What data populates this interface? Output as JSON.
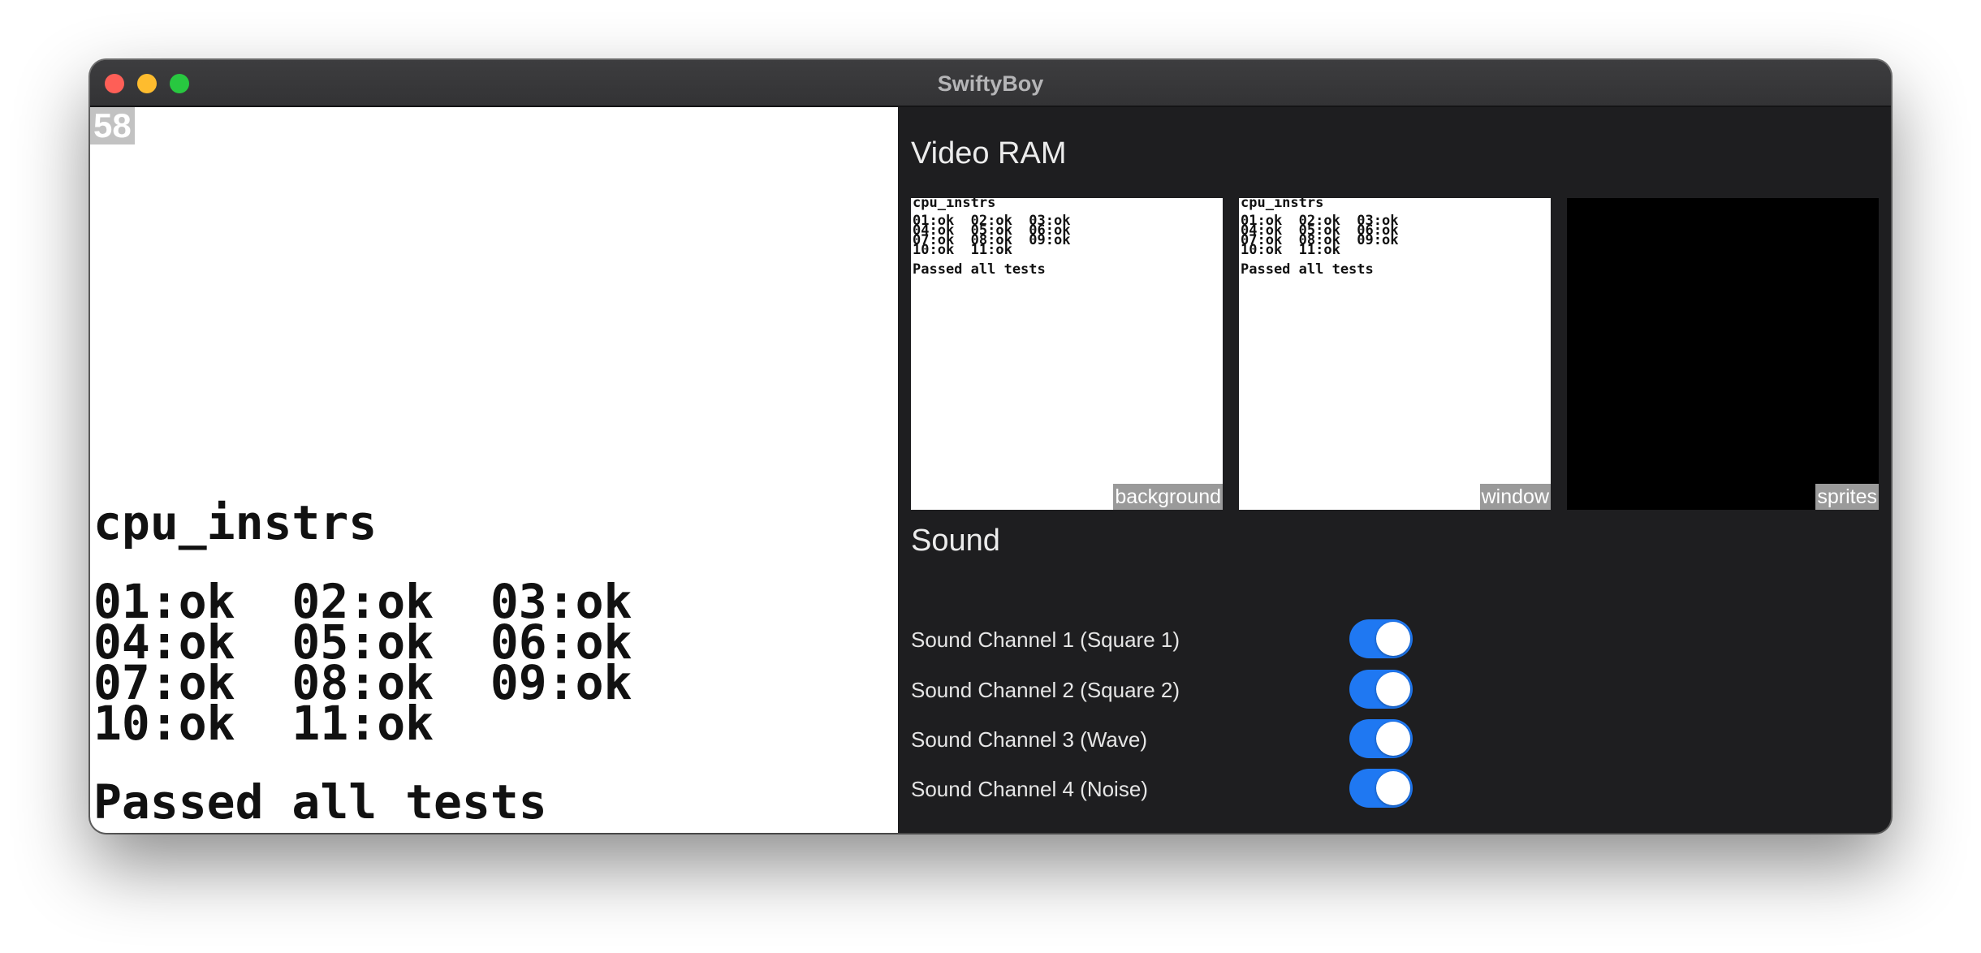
{
  "window": {
    "title": "SwiftyBoy"
  },
  "screen": {
    "fps": "58",
    "title": "cpu_instrs",
    "results": "01:ok  02:ok  03:ok\n04:ok  05:ok  06:ok\n07:ok  08:ok  09:ok\n10:ok  11:ok",
    "passed": "Passed all tests"
  },
  "vram": {
    "title": "Video RAM",
    "tiles": [
      {
        "label": "background",
        "title": "cpu_instrs",
        "results": "01:ok  02:ok  03:ok\n04:ok  05:ok  06:ok\n07:ok  08:ok  09:ok\n10:ok  11:ok",
        "passed": "Passed all tests"
      },
      {
        "label": "window",
        "title": "cpu_instrs",
        "results": "01:ok  02:ok  03:ok\n04:ok  05:ok  06:ok\n07:ok  08:ok  09:ok\n10:ok  11:ok",
        "passed": "Passed all tests"
      },
      {
        "label": "sprites"
      }
    ]
  },
  "sound": {
    "title": "Sound",
    "channels": [
      {
        "label": "Sound Channel 1 (Square 1)",
        "enabled": true
      },
      {
        "label": "Sound Channel 2 (Square 2)",
        "enabled": true
      },
      {
        "label": "Sound Channel 3 (Wave)",
        "enabled": true
      },
      {
        "label": "Sound Channel 4 (Noise)",
        "enabled": true
      }
    ]
  },
  "colors": {
    "traffic_close": "#fe5f57",
    "traffic_minimize": "#febc2e",
    "traffic_zoom": "#28c840",
    "toggle_on": "#1f78f2",
    "panel_background": "#1e1e20"
  }
}
